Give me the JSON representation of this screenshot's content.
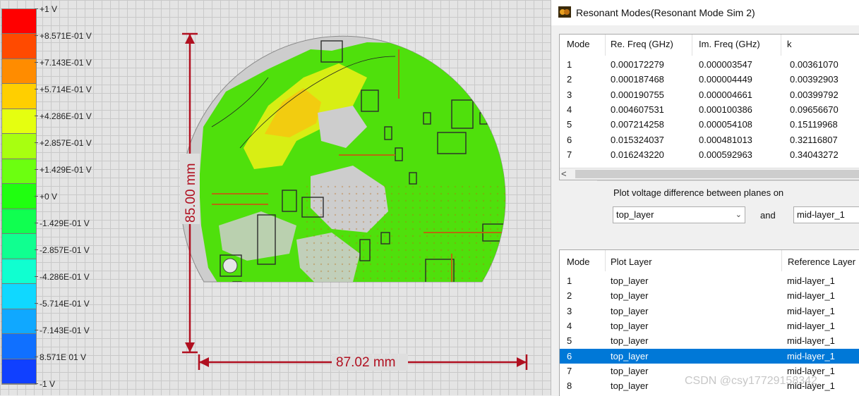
{
  "legend": {
    "colors": [
      "#ff0000",
      "#ff4a00",
      "#ff8c00",
      "#ffcf00",
      "#e5ff10",
      "#a8ff10",
      "#6cff10",
      "#20ff10",
      "#10ff50",
      "#10ff90",
      "#10ffd0",
      "#10d8ff",
      "#10a8ff",
      "#1070ff",
      "#1040ff"
    ],
    "labels": [
      "+1 V",
      "+8.571E-01 V",
      "+7.143E-01 V",
      "+5.714E-01 V",
      "+4.286E-01 V",
      "+2.857E-01 V",
      "+1.429E-01 V",
      "+0 V",
      "-1.429E-01 V",
      "-2.857E-01 V",
      "-4.286E-01 V",
      "-5.714E-01 V",
      "-7.143E-01 V",
      "8.571E 01 V",
      "-1 V"
    ]
  },
  "board": {
    "height_dim": "85.00 mm",
    "width_dim": "87.02 mm",
    "colors": {
      "dimension": "#b01020",
      "board_fill": "#cdcdcd",
      "green": "#4fe00c",
      "yellow": "#e8e40a",
      "orange": "#f4c010",
      "trace": "#b86a10"
    }
  },
  "window": {
    "title": "Resonant Modes(Resonant Mode Sim 2)",
    "icon": "resonant-mode-icon"
  },
  "modes_table": {
    "headers": [
      "Mode",
      "Re. Freq (GHz)",
      "Im. Freq (GHz)",
      "k"
    ],
    "rows": [
      [
        "1",
        "0.000172279",
        "0.000003547",
        "0.00361070"
      ],
      [
        "2",
        "0.000187468",
        "0.000004449",
        "0.00392903"
      ],
      [
        "3",
        "0.000190755",
        "0.000004661",
        "0.00399792"
      ],
      [
        "4",
        "0.004607531",
        "0.000100386",
        "0.09656670"
      ],
      [
        "5",
        "0.007214258",
        "0.000054108",
        "0.15119968"
      ],
      [
        "6",
        "0.015324037",
        "0.000481013",
        "0.32116807"
      ],
      [
        "7",
        "0.016243220",
        "0.000592963",
        "0.34043272"
      ]
    ],
    "scroll_left": "<"
  },
  "plot_group": {
    "label": "Plot voltage difference between planes on",
    "plane1": "top_layer",
    "and_label": "and",
    "plane2": "mid-layer_1"
  },
  "layers_table": {
    "headers": [
      "Mode",
      "Plot Layer",
      "Reference Layer"
    ],
    "rows": [
      [
        "1",
        "top_layer",
        "mid-layer_1"
      ],
      [
        "2",
        "top_layer",
        "mid-layer_1"
      ],
      [
        "3",
        "top_layer",
        "mid-layer_1"
      ],
      [
        "4",
        "top_layer",
        "mid-layer_1"
      ],
      [
        "5",
        "top_layer",
        "mid-layer_1"
      ],
      [
        "6",
        "top_layer",
        "mid-layer_1"
      ],
      [
        "7",
        "top_layer",
        "mid-layer_1"
      ],
      [
        "8",
        "top_layer",
        "mid-layer_1"
      ]
    ],
    "selected_mode": "6",
    "selected_color": "#0078d7"
  },
  "watermark": "CSDN @csy17729158342"
}
